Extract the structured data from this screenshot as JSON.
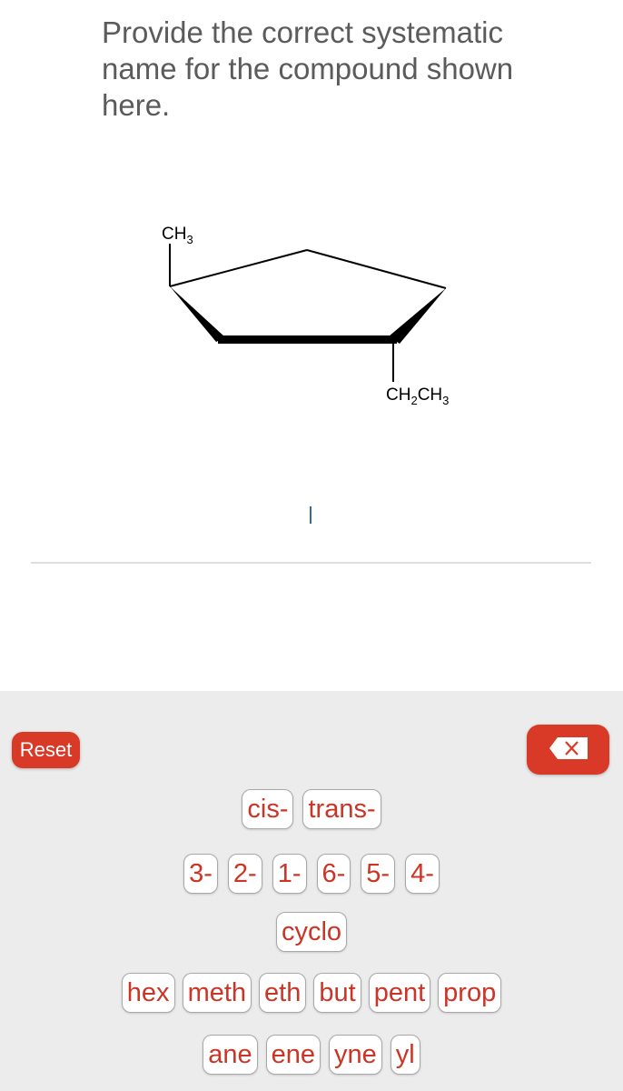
{
  "question": {
    "prompt": "Provide the correct systematic name for the compound shown here."
  },
  "structure": {
    "description": "cyclopentane ring with wedge bonds at front edge",
    "substituents": [
      {
        "label_main": "CH",
        "label_sub": "3",
        "position": "top-left carbon"
      },
      {
        "label_main": "CH",
        "label_sub1": "2",
        "label_mid": "CH",
        "label_sub2": "3",
        "position": "bottom-right carbon"
      }
    ]
  },
  "answer": {
    "value": ""
  },
  "keypad": {
    "reset_label": "Reset",
    "backspace_icon": "backspace-icon",
    "rows": [
      [
        "cis-",
        "trans-"
      ],
      [
        "3-",
        "2-",
        "1-",
        "6-",
        "5-",
        "4-"
      ],
      [
        "cyclo"
      ],
      [
        "hex",
        "meth",
        "eth",
        "but",
        "pent",
        "prop"
      ],
      [
        "ane",
        "ene",
        "yne",
        "yl"
      ]
    ]
  },
  "colors": {
    "accent": "#d93a28",
    "key_text": "#cc3425",
    "keypad_bg": "#ececec",
    "caret": "#2f6da3"
  }
}
